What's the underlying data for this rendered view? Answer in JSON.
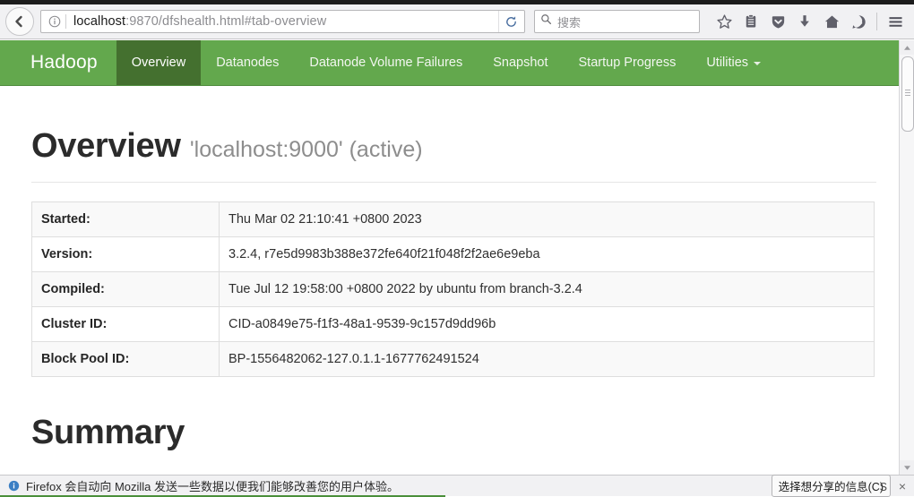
{
  "browser": {
    "back_button": "back-arrow",
    "url": {
      "host": "localhost",
      "rest": ":9870/dfshealth.html#tab-overview",
      "full": "localhost:9870/dfshealth.html#tab-overview"
    },
    "identity_icon": "info-circle-icon",
    "reload_icon": "reload-icon",
    "search": {
      "placeholder": "搜索",
      "icon": "search-icon"
    },
    "toolbar_icons": [
      "star-bookmark-icon",
      "library-clipboard-icon",
      "pocket-shield-icon",
      "downloads-arrow-icon",
      "home-icon",
      "feedback-smiley-icon",
      "hamburger-menu-icon"
    ]
  },
  "hadoop": {
    "brand": "Hadoop",
    "nav_items": [
      {
        "label": "Overview",
        "active": true,
        "dropdown": false
      },
      {
        "label": "Datanodes",
        "active": false,
        "dropdown": false
      },
      {
        "label": "Datanode Volume Failures",
        "active": false,
        "dropdown": false
      },
      {
        "label": "Snapshot",
        "active": false,
        "dropdown": false
      },
      {
        "label": "Startup Progress",
        "active": false,
        "dropdown": false
      },
      {
        "label": "Utilities",
        "active": false,
        "dropdown": true
      }
    ],
    "colors": {
      "navbar_bg": "#63a84d",
      "navbar_active_bg": "#44702f",
      "navbar_text": "#f2f6f0"
    }
  },
  "page": {
    "overview_title": "Overview",
    "overview_subtitle": "'localhost:9000' (active)",
    "summary_title": "Summary",
    "info_rows": [
      {
        "key": "Started:",
        "value": "Thu Mar 02 21:10:41 +0800 2023"
      },
      {
        "key": "Version:",
        "value": "3.2.4, r7e5d9983b388e372fe640f21f048f2f2ae6e9eba"
      },
      {
        "key": "Compiled:",
        "value": "Tue Jul 12 19:58:00 +0800 2022 by ubuntu from branch-3.2.4"
      },
      {
        "key": "Cluster ID:",
        "value": "CID-a0849e75-f1f3-48a1-9539-9c157d9dd96b"
      },
      {
        "key": "Block Pool ID:",
        "value": "BP-1556482062-127.0.1.1-1677762491524"
      }
    ]
  },
  "notification": {
    "icon": "info-icon",
    "message": "Firefox 会自动向 Mozilla 发送一些数据以便我们能够改善您的用户体验。",
    "button_label": "选择想分享的信息(C)",
    "overlay_label": "S",
    "close_label": "×"
  },
  "scrollbar": {
    "up_arrow": "scroll-up-arrow-icon",
    "down_arrow": "scroll-down-arrow-icon"
  }
}
